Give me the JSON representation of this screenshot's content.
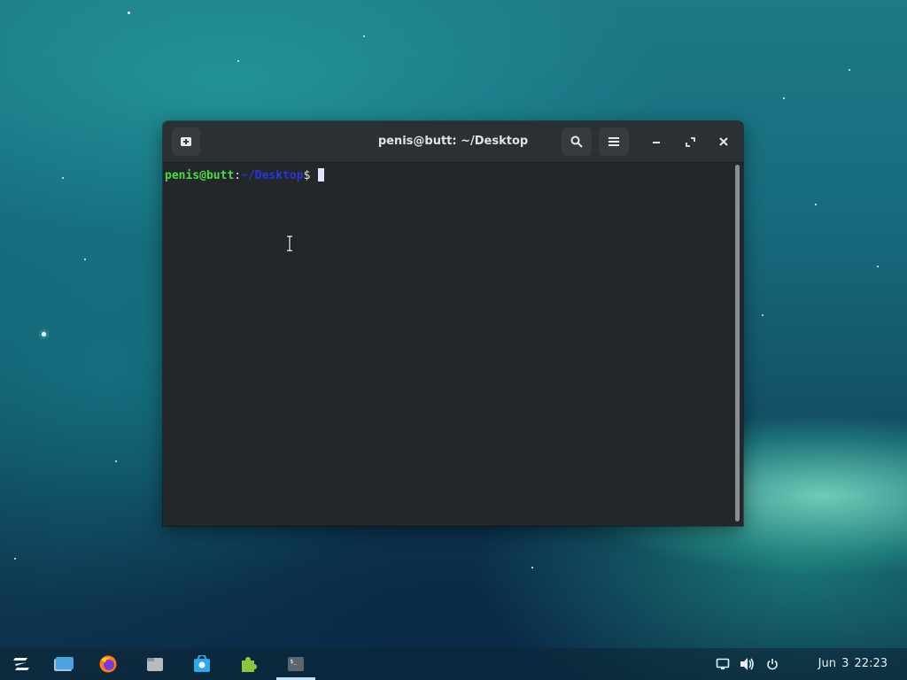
{
  "window": {
    "title": "penis@butt: ~/Desktop",
    "buttons": [
      "new-tab",
      "search",
      "menu",
      "minimize",
      "maximize",
      "close"
    ]
  },
  "terminal": {
    "prompt_user_host": "penis@butt",
    "prompt_colon": ":",
    "prompt_path": "~/Desktop",
    "prompt_symbol": "$ "
  },
  "taskbar": {
    "launchers": [
      {
        "name": "zorin-menu-icon",
        "active": false
      },
      {
        "name": "workspaces-icon",
        "active": false
      },
      {
        "name": "firefox-icon",
        "active": false
      },
      {
        "name": "files-icon",
        "active": false
      },
      {
        "name": "software-icon",
        "active": false
      },
      {
        "name": "extensions-icon",
        "active": false
      },
      {
        "name": "terminal-icon",
        "active": true
      }
    ],
    "tray": [
      "screen-icon",
      "volume-icon",
      "power-icon"
    ],
    "clock": {
      "date": "Jun 3",
      "time": "22:23"
    }
  },
  "colors": {
    "prompt_user": "#4fd84a",
    "prompt_path": "#2a35d8",
    "terminal_bg": "#232729",
    "titlebar_bg": "#2b3033"
  }
}
